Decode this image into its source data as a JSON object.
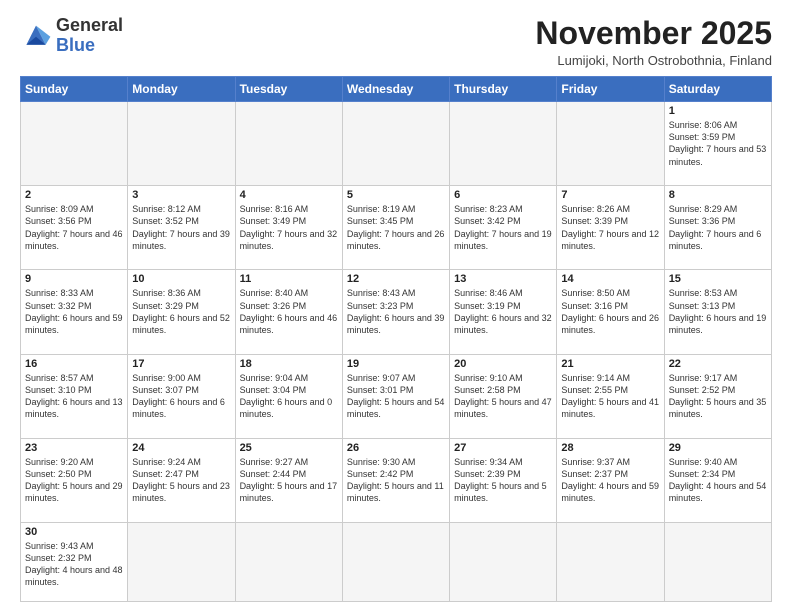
{
  "logo": {
    "general": "General",
    "blue": "Blue"
  },
  "title": "November 2025",
  "subtitle": "Lumijoki, North Ostrobothnia, Finland",
  "days_of_week": [
    "Sunday",
    "Monday",
    "Tuesday",
    "Wednesday",
    "Thursday",
    "Friday",
    "Saturday"
  ],
  "weeks": [
    [
      {
        "day": "",
        "info": "",
        "empty": true
      },
      {
        "day": "",
        "info": "",
        "empty": true
      },
      {
        "day": "",
        "info": "",
        "empty": true
      },
      {
        "day": "",
        "info": "",
        "empty": true
      },
      {
        "day": "",
        "info": "",
        "empty": true
      },
      {
        "day": "",
        "info": "",
        "empty": true
      },
      {
        "day": "1",
        "info": "Sunrise: 8:06 AM\nSunset: 3:59 PM\nDaylight: 7 hours\nand 53 minutes."
      }
    ],
    [
      {
        "day": "2",
        "info": "Sunrise: 8:09 AM\nSunset: 3:56 PM\nDaylight: 7 hours\nand 46 minutes."
      },
      {
        "day": "3",
        "info": "Sunrise: 8:12 AM\nSunset: 3:52 PM\nDaylight: 7 hours\nand 39 minutes."
      },
      {
        "day": "4",
        "info": "Sunrise: 8:16 AM\nSunset: 3:49 PM\nDaylight: 7 hours\nand 32 minutes."
      },
      {
        "day": "5",
        "info": "Sunrise: 8:19 AM\nSunset: 3:45 PM\nDaylight: 7 hours\nand 26 minutes."
      },
      {
        "day": "6",
        "info": "Sunrise: 8:23 AM\nSunset: 3:42 PM\nDaylight: 7 hours\nand 19 minutes."
      },
      {
        "day": "7",
        "info": "Sunrise: 8:26 AM\nSunset: 3:39 PM\nDaylight: 7 hours\nand 12 minutes."
      },
      {
        "day": "8",
        "info": "Sunrise: 8:29 AM\nSunset: 3:36 PM\nDaylight: 7 hours\nand 6 minutes."
      }
    ],
    [
      {
        "day": "9",
        "info": "Sunrise: 8:33 AM\nSunset: 3:32 PM\nDaylight: 6 hours\nand 59 minutes."
      },
      {
        "day": "10",
        "info": "Sunrise: 8:36 AM\nSunset: 3:29 PM\nDaylight: 6 hours\nand 52 minutes."
      },
      {
        "day": "11",
        "info": "Sunrise: 8:40 AM\nSunset: 3:26 PM\nDaylight: 6 hours\nand 46 minutes."
      },
      {
        "day": "12",
        "info": "Sunrise: 8:43 AM\nSunset: 3:23 PM\nDaylight: 6 hours\nand 39 minutes."
      },
      {
        "day": "13",
        "info": "Sunrise: 8:46 AM\nSunset: 3:19 PM\nDaylight: 6 hours\nand 32 minutes."
      },
      {
        "day": "14",
        "info": "Sunrise: 8:50 AM\nSunset: 3:16 PM\nDaylight: 6 hours\nand 26 minutes."
      },
      {
        "day": "15",
        "info": "Sunrise: 8:53 AM\nSunset: 3:13 PM\nDaylight: 6 hours\nand 19 minutes."
      }
    ],
    [
      {
        "day": "16",
        "info": "Sunrise: 8:57 AM\nSunset: 3:10 PM\nDaylight: 6 hours\nand 13 minutes."
      },
      {
        "day": "17",
        "info": "Sunrise: 9:00 AM\nSunset: 3:07 PM\nDaylight: 6 hours\nand 6 minutes."
      },
      {
        "day": "18",
        "info": "Sunrise: 9:04 AM\nSunset: 3:04 PM\nDaylight: 6 hours\nand 0 minutes."
      },
      {
        "day": "19",
        "info": "Sunrise: 9:07 AM\nSunset: 3:01 PM\nDaylight: 5 hours\nand 54 minutes."
      },
      {
        "day": "20",
        "info": "Sunrise: 9:10 AM\nSunset: 2:58 PM\nDaylight: 5 hours\nand 47 minutes."
      },
      {
        "day": "21",
        "info": "Sunrise: 9:14 AM\nSunset: 2:55 PM\nDaylight: 5 hours\nand 41 minutes."
      },
      {
        "day": "22",
        "info": "Sunrise: 9:17 AM\nSunset: 2:52 PM\nDaylight: 5 hours\nand 35 minutes."
      }
    ],
    [
      {
        "day": "23",
        "info": "Sunrise: 9:20 AM\nSunset: 2:50 PM\nDaylight: 5 hours\nand 29 minutes."
      },
      {
        "day": "24",
        "info": "Sunrise: 9:24 AM\nSunset: 2:47 PM\nDaylight: 5 hours\nand 23 minutes."
      },
      {
        "day": "25",
        "info": "Sunrise: 9:27 AM\nSunset: 2:44 PM\nDaylight: 5 hours\nand 17 minutes."
      },
      {
        "day": "26",
        "info": "Sunrise: 9:30 AM\nSunset: 2:42 PM\nDaylight: 5 hours\nand 11 minutes."
      },
      {
        "day": "27",
        "info": "Sunrise: 9:34 AM\nSunset: 2:39 PM\nDaylight: 5 hours\nand 5 minutes."
      },
      {
        "day": "28",
        "info": "Sunrise: 9:37 AM\nSunset: 2:37 PM\nDaylight: 4 hours\nand 59 minutes."
      },
      {
        "day": "29",
        "info": "Sunrise: 9:40 AM\nSunset: 2:34 PM\nDaylight: 4 hours\nand 54 minutes."
      }
    ],
    [
      {
        "day": "30",
        "info": "Sunrise: 9:43 AM\nSunset: 2:32 PM\nDaylight: 4 hours\nand 48 minutes.",
        "last": true
      },
      {
        "day": "",
        "info": "",
        "empty": true,
        "last": true
      },
      {
        "day": "",
        "info": "",
        "empty": true,
        "last": true
      },
      {
        "day": "",
        "info": "",
        "empty": true,
        "last": true
      },
      {
        "day": "",
        "info": "",
        "empty": true,
        "last": true
      },
      {
        "day": "",
        "info": "",
        "empty": true,
        "last": true
      },
      {
        "day": "",
        "info": "",
        "empty": true,
        "last": true
      }
    ]
  ]
}
